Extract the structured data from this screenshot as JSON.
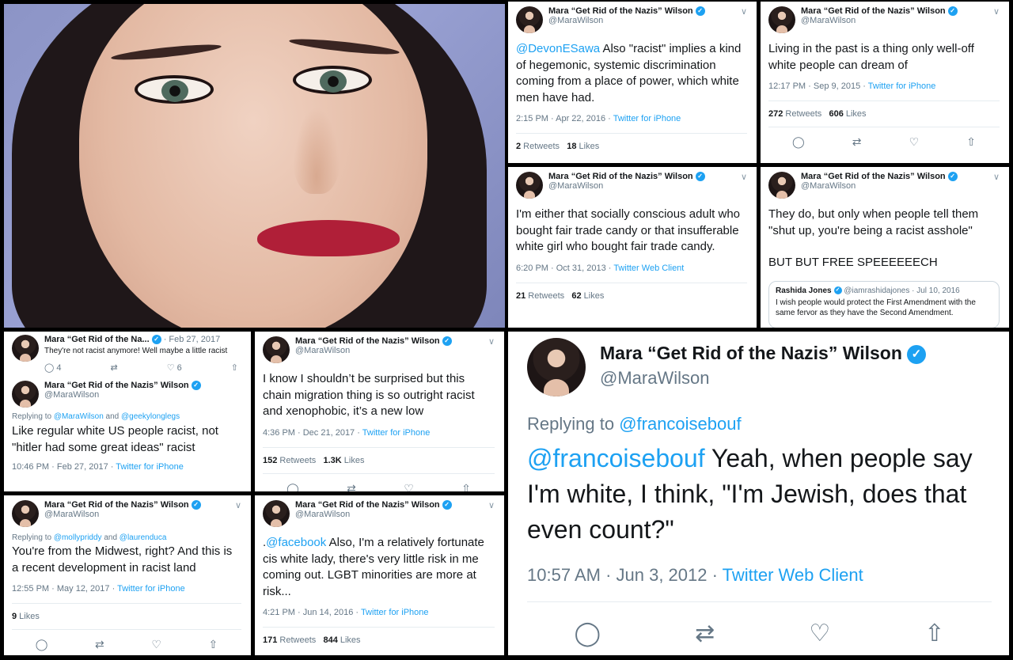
{
  "author": {
    "name": "Mara “Get Rid of the Nazis” Wilson",
    "handle": "@MaraWilson"
  },
  "tweets": {
    "t1": {
      "mention": "@DevonESawa",
      "text": " Also \"racist\" implies a kind of hegemonic, systemic discrimination coming from a place of power, which white men have had.",
      "time": "2:15 PM · Apr 22, 2016 · ",
      "source": "Twitter for iPhone",
      "retweets": "2",
      "retweets_label": " Retweets",
      "likes": "18",
      "likes_label": " Likes"
    },
    "t2": {
      "text": "Living in the past is a thing only well-off white people can dream of",
      "time": "12:17 PM · Sep 9, 2015 · ",
      "source": "Twitter for iPhone",
      "retweets": "272",
      "retweets_label": " Retweets",
      "likes": "606",
      "likes_label": " Likes"
    },
    "t3": {
      "text": "I'm either that socially conscious adult who bought fair trade candy or that insufferable white girl who bought fair trade candy.",
      "time": "6:20 PM · Oct 31, 2013 · ",
      "source": "Twitter Web Client",
      "retweets": "21",
      "retweets_label": " Retweets",
      "likes": "62",
      "likes_label": " Likes"
    },
    "t4": {
      "text": "They do, but only when people tell them \"shut up, you're being a racist asshole\"",
      "text2": "BUT BUT FREE SPEEEEEECH",
      "quote": {
        "name": "Rashida Jones",
        "handle_date": "@iamrashidajones · Jul 10, 2016",
        "text": "I wish people would protect the First Amendment with the same fervor as they have the Second Amendment."
      }
    },
    "t5": {
      "parent": {
        "name": "Mara “Get Rid of the Na...",
        "date": "· Feb 27, 2017",
        "text": "They're not racist anymore! Well maybe a little racist",
        "replies": "4",
        "likes": "6"
      },
      "replying_prefix": "Replying to ",
      "replying_links": "@MaraWilson",
      "replying_and": " and ",
      "replying_links2": "@geekylonglegs",
      "text": "Like regular white US people racist, not \"hitler had some great ideas\" racist",
      "time": "10:46 PM · Feb 27, 2017 · ",
      "source": "Twitter for iPhone"
    },
    "t6": {
      "text": "I know I shouldn’t be surprised but this chain migration thing is so outright racist and xenophobic, it’s a new low",
      "time": "4:36 PM · Dec 21, 2017 · ",
      "source": "Twitter for iPhone",
      "retweets": "152",
      "retweets_label": " Retweets",
      "likes": "1.3K",
      "likes_label": " Likes"
    },
    "t7": {
      "replying_prefix": "Replying to ",
      "replying_links": "@mollypriddy",
      "replying_and": " and ",
      "replying_links2": "@laurenduca",
      "text": "You're from the Midwest, right? And this is a recent development in racist land",
      "time": "12:55 PM · May 12, 2017 · ",
      "source": "Twitter for iPhone",
      "likes": "9",
      "likes_label": " Likes"
    },
    "t8": {
      "prefix": ".",
      "mention": "@facebook",
      "text": " Also, I'm a relatively fortunate cis white lady, there's very little risk in me coming out. LGBT minorities are more at risk...",
      "time": "4:21 PM · Jun 14, 2016 · ",
      "source": "Twitter for iPhone",
      "retweets": "171",
      "retweets_label": " Retweets",
      "likes": "844",
      "likes_label": " Likes"
    },
    "t9": {
      "replying_prefix": "Replying to ",
      "replying_link": "@francoisebouf",
      "mention": "@francoisebouf",
      "text": " Yeah, when people say I'm white, I think, \"I'm Jewish, does that even count?\"",
      "time": "10:57 AM · Jun 3, 2012 · ",
      "source": "Twitter Web Client"
    }
  },
  "icons": {
    "reply": "◯",
    "retweet": "⇄",
    "like": "♡",
    "share": "⇧",
    "chevron": "∨",
    "verified": "✓"
  },
  "colors": {
    "accent": "#1da1f2",
    "muted": "#657786",
    "background": "#000000"
  }
}
